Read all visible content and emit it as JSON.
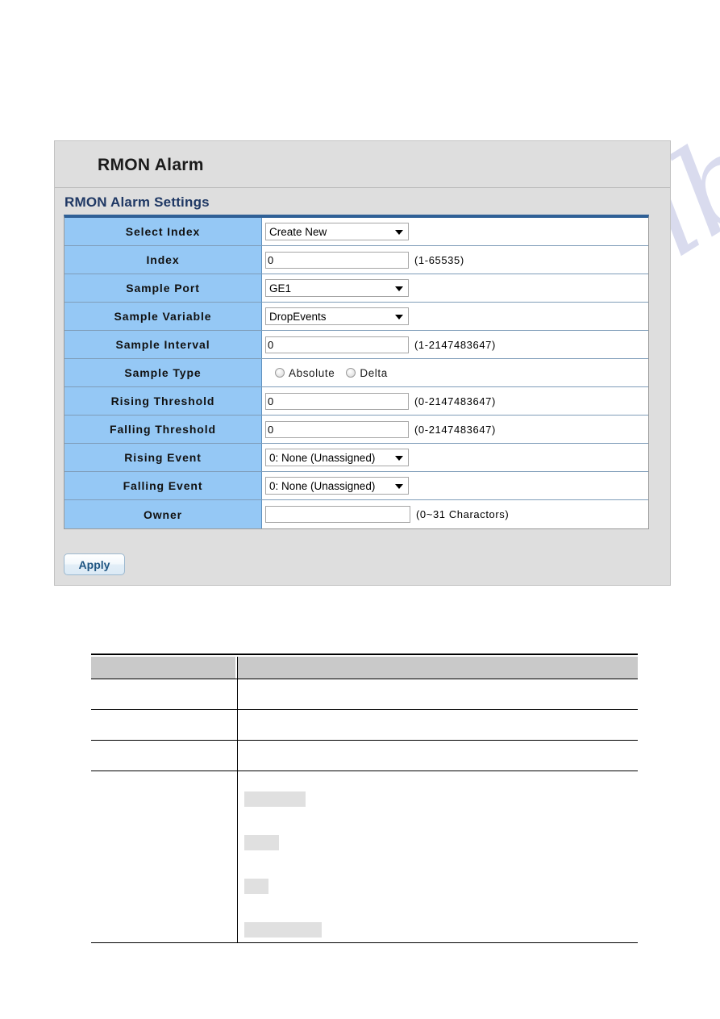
{
  "panel": {
    "title": "RMON Alarm",
    "section_title": "RMON Alarm Settings",
    "apply_label": "Apply"
  },
  "form": {
    "rows": [
      {
        "label": "Select Index",
        "control": "select",
        "value": "Create New",
        "hint": ""
      },
      {
        "label": "Index",
        "control": "text",
        "value": "0",
        "hint": "(1-65535)"
      },
      {
        "label": "Sample Port",
        "control": "select",
        "value": "GE1",
        "hint": ""
      },
      {
        "label": "Sample Variable",
        "control": "select",
        "value": "DropEvents",
        "hint": ""
      },
      {
        "label": "Sample Interval",
        "control": "text",
        "value": "0",
        "hint": "(1-2147483647)"
      },
      {
        "label": "Sample Type",
        "control": "radio",
        "value": "",
        "hint": "",
        "options": [
          {
            "label": "Absolute",
            "selected": false
          },
          {
            "label": "Delta",
            "selected": false
          }
        ]
      },
      {
        "label": "Rising Threshold",
        "control": "text",
        "value": "0",
        "hint": "(0-2147483647)"
      },
      {
        "label": "Falling Threshold",
        "control": "text",
        "value": "0",
        "hint": "(0-2147483647)"
      },
      {
        "label": "Rising Event",
        "control": "select",
        "value": "0: None (Unassigned)",
        "hint": ""
      },
      {
        "label": "Falling Event",
        "control": "select",
        "value": "0: None (Unassigned)",
        "hint": ""
      },
      {
        "label": "Owner",
        "control": "text",
        "value": "",
        "hint": "(0~31 Charactors)"
      }
    ]
  },
  "description_table": {
    "header": {
      "col1": "",
      "col2": ""
    },
    "rows": [
      {
        "col1": "",
        "col2": ""
      },
      {
        "col1": "",
        "col2": ""
      },
      {
        "col1": "",
        "col2": ""
      },
      {
        "col1": "",
        "col2": ""
      }
    ]
  },
  "watermark": {
    "text": "manualslib.com"
  },
  "colors": {
    "label_blue": "#95c8f5",
    "table_top_border": "#2f6096",
    "panel_background": "#dedede",
    "section_title": "#1f3864",
    "apply_text": "#1f5582",
    "watermark": "#c9cde8",
    "redaction": "#e0e0e0"
  }
}
